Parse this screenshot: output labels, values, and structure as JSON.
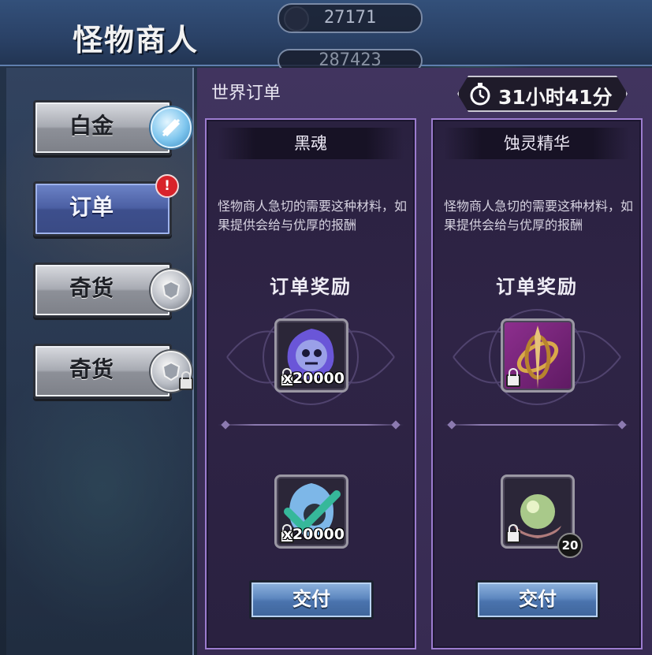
{
  "header": {
    "title": "怪物商人",
    "currency_top": "27171",
    "currency_second": "287423"
  },
  "nav": {
    "items": [
      {
        "label": "白金",
        "icon": "platinum-coin-icon"
      },
      {
        "label": "订单",
        "icon": "alert-icon",
        "badge": "!"
      },
      {
        "label": "奇货",
        "icon": "silver-coin-icon"
      },
      {
        "label": "奇货",
        "icon": "silver-coin-icon"
      }
    ],
    "active_index": 1
  },
  "panel": {
    "title": "世界订单",
    "timer": "31小时41分"
  },
  "orders": [
    {
      "name": "黑魂",
      "description": "怪物商人急切的需要这种材料，如果提供会给与优厚的报酬",
      "reward_title": "订单奖励",
      "reward_items": [
        {
          "icon": "black-soul-icon",
          "qty": "x20000"
        },
        {
          "icon": "spirit-check-icon",
          "qty": "x20000"
        }
      ],
      "button": "交付"
    },
    {
      "name": "蚀灵精华",
      "description": "怪物商人急切的需要这种材料，如果提供会给与优厚的报酬",
      "reward_title": "订单奖励",
      "reward_items": [
        {
          "icon": "golden-armillary-icon",
          "qty": ""
        },
        {
          "icon": "pearl-shell-icon",
          "qty": "",
          "count": "20"
        }
      ],
      "button": "交付"
    }
  ],
  "colors": {
    "panel_bg": "#41345f",
    "card_border": "#9c7ccf",
    "active_tab": "#4b5fa3",
    "deliver_button": "#5e88c0",
    "alert_badge": "#d8232a"
  }
}
